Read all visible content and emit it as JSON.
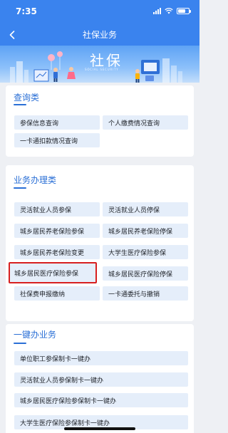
{
  "status_bar": {
    "time": "7:35"
  },
  "nav": {
    "title": "社保业务"
  },
  "banner": {
    "title": "社保",
    "subtitle": "SOCIAL SECURITY"
  },
  "sections": {
    "query": {
      "title": "查询类",
      "items": [
        "参保信息查询",
        "个人缴费情况查询",
        "一卡通扣款情况查询"
      ]
    },
    "business": {
      "title": "业务办理类",
      "items": [
        "灵活就业人员参保",
        "灵活就业人员停保",
        "城乡居民养老保险参保",
        "城乡居民养老保险停保",
        "城乡居民养老保险变更",
        "大学生医疗保险参保",
        "城乡居民医疗保险参保",
        "城乡居民医疗保险停保",
        "社保费申报缴纳",
        "一卡通委托与撤销"
      ]
    },
    "oneclick": {
      "title": "一键办业务",
      "items": [
        "单位职工参保制卡一键办",
        "灵活就业人员参保制卡一键办",
        "城乡居民医疗保险参保制卡一键办",
        "大学生医疗保险参保制卡一键办"
      ]
    }
  },
  "colors": {
    "header": "#3a83ee",
    "accent": "#2a6fd6",
    "button_bg": "#e5eefa",
    "highlight_border": "#d71f1f"
  }
}
